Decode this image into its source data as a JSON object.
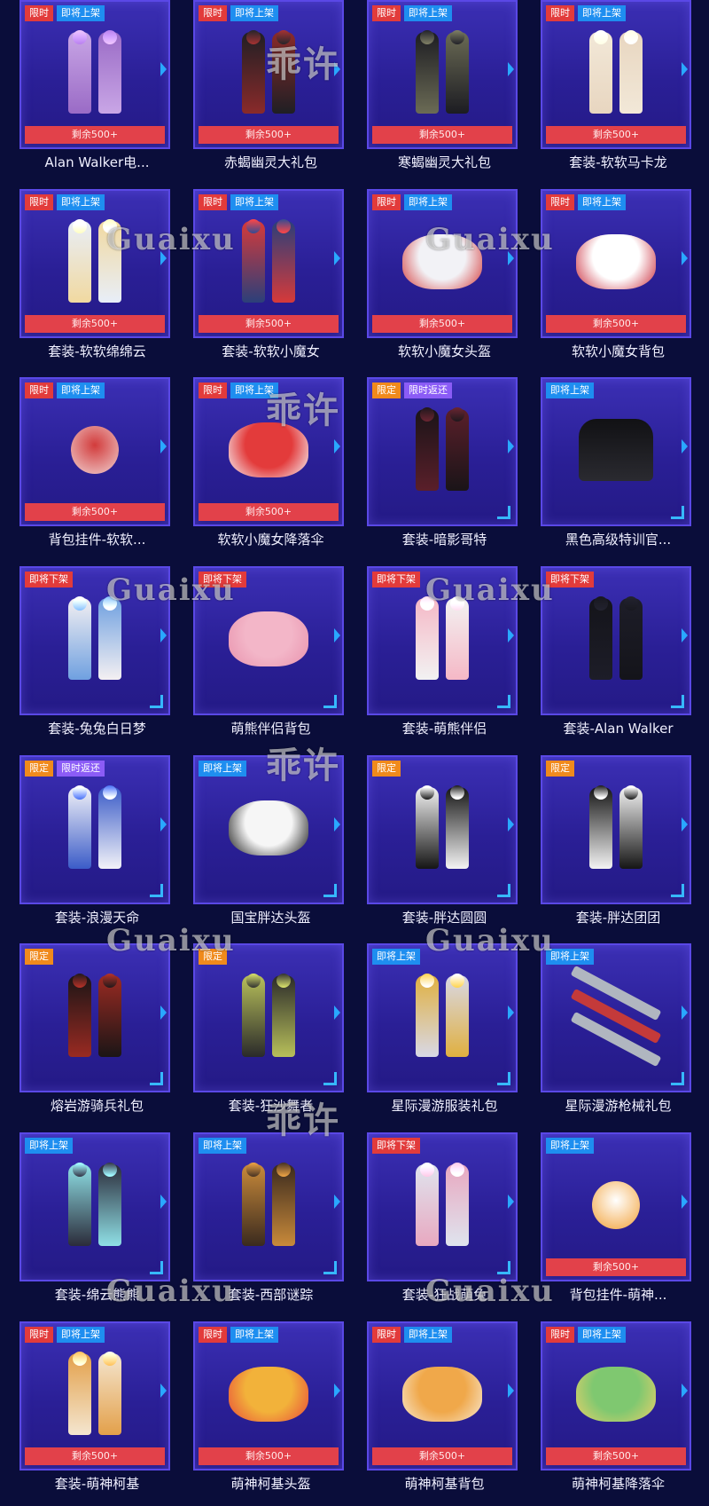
{
  "labels": {
    "limited": "限时",
    "fixed": "限定",
    "soon_on": "即将上架",
    "soon_off": "即将下架",
    "return": "限时返还",
    "remaining": "剩余500+"
  },
  "watermarks": [
    "乖许",
    "Guaixu"
  ],
  "colors": {
    "card": "#3b2fb4",
    "remaining_bar": "#e2414a",
    "badge_red": "#e23b3b",
    "badge_orange": "#f08a1c",
    "badge_blue": "#1e8ef0",
    "badge_purple": "#8b5cf6",
    "corner_accent": "#36b8ff"
  },
  "items": [
    {
      "name": "Alan Walker电...",
      "badges": [
        "limited",
        "soon_on"
      ],
      "remaining": true,
      "art": "figures",
      "tone": [
        "#c9a6e6",
        "#9a6bc6"
      ]
    },
    {
      "name": "赤蝎幽灵大礼包",
      "badges": [
        "limited",
        "soon_on"
      ],
      "remaining": true,
      "art": "figures",
      "tone": [
        "#1f1f24",
        "#8a2a2a"
      ]
    },
    {
      "name": "寒蝎幽灵大礼包",
      "badges": [
        "limited",
        "soon_on"
      ],
      "remaining": true,
      "art": "figures",
      "tone": [
        "#1c1c22",
        "#6b6b55"
      ]
    },
    {
      "name": "套装-软软马卡龙",
      "badges": [
        "limited",
        "soon_on"
      ],
      "remaining": true,
      "art": "figures",
      "tone": [
        "#f2e8d8",
        "#e8d6c0"
      ]
    },
    {
      "name": "套装-软软绵绵云",
      "badges": [
        "limited",
        "soon_on"
      ],
      "remaining": true,
      "art": "figures",
      "tone": [
        "#e8eef8",
        "#f1d9a0"
      ]
    },
    {
      "name": "套装-软软小魔女",
      "badges": [
        "limited",
        "soon_on"
      ],
      "remaining": true,
      "art": "figures",
      "tone": [
        "#d63a3a",
        "#2b3f7a"
      ]
    },
    {
      "name": "软软小魔女头盔",
      "badges": [
        "limited",
        "soon_on"
      ],
      "remaining": true,
      "art": "blob",
      "tone": [
        "#f2f2f6",
        "#d43a3a"
      ]
    },
    {
      "name": "软软小魔女背包",
      "badges": [
        "limited",
        "soon_on"
      ],
      "remaining": true,
      "art": "blob",
      "tone": [
        "#ffffff",
        "#c92a3a"
      ]
    },
    {
      "name": "背包挂件-软软...",
      "badges": [
        "limited",
        "soon_on"
      ],
      "remaining": true,
      "art": "charm",
      "tone": [
        "#f0d0d0",
        "#d23b3b"
      ]
    },
    {
      "name": "软软小魔女降落伞",
      "badges": [
        "limited",
        "soon_on"
      ],
      "remaining": true,
      "art": "blob",
      "tone": [
        "#e33b3b",
        "#f6f6fa"
      ]
    },
    {
      "name": "套装-暗影哥特",
      "badges": [
        "fixed",
        "return"
      ],
      "remaining": false,
      "art": "figures",
      "tone": [
        "#1a1418",
        "#5a1f2a"
      ]
    },
    {
      "name": "黑色高级特训官...",
      "badges": [
        "soon_on"
      ],
      "remaining": false,
      "art": "shirt",
      "tone": [
        "#111114",
        "#2a2a30"
      ]
    },
    {
      "name": "套装-兔兔白日梦",
      "badges": [
        "soon_off"
      ],
      "remaining": false,
      "art": "figures",
      "tone": [
        "#f4f0f2",
        "#6fa0e0"
      ]
    },
    {
      "name": "萌熊伴侣背包",
      "badges": [
        "soon_off"
      ],
      "remaining": false,
      "art": "blob",
      "tone": [
        "#f3b6c8",
        "#e892ad"
      ]
    },
    {
      "name": "套装-萌熊伴侣",
      "badges": [
        "soon_off"
      ],
      "remaining": false,
      "art": "figures",
      "tone": [
        "#f5b8c6",
        "#f2f2f2"
      ]
    },
    {
      "name": "套装-Alan Walker",
      "badges": [
        "soon_off"
      ],
      "remaining": false,
      "art": "figures",
      "tone": [
        "#14141a",
        "#1d1d28"
      ]
    },
    {
      "name": "套装-浪漫天命",
      "badges": [
        "fixed",
        "return"
      ],
      "remaining": false,
      "art": "figures",
      "tone": [
        "#f2f2f8",
        "#3b5cc8"
      ]
    },
    {
      "name": "国宝胖达头盔",
      "badges": [
        "soon_on"
      ],
      "remaining": false,
      "art": "blob",
      "tone": [
        "#f6f6f6",
        "#151515"
      ]
    },
    {
      "name": "套装-胖达圆圆",
      "badges": [
        "fixed"
      ],
      "remaining": false,
      "art": "figures",
      "tone": [
        "#f4f4f4",
        "#151515"
      ]
    },
    {
      "name": "套装-胖达团团",
      "badges": [
        "fixed"
      ],
      "remaining": false,
      "art": "figures",
      "tone": [
        "#151515",
        "#f4f4f4"
      ]
    },
    {
      "name": "熔岩游骑兵礼包",
      "badges": [
        "fixed"
      ],
      "remaining": false,
      "art": "figures",
      "tone": [
        "#1b1516",
        "#9a2a22"
      ]
    },
    {
      "name": "套装-狂沙舞者",
      "badges": [
        "fixed"
      ],
      "remaining": false,
      "art": "figures",
      "tone": [
        "#b8c05a",
        "#2a2a2a"
      ]
    },
    {
      "name": "星际漫游服装礼包",
      "badges": [
        "soon_on"
      ],
      "remaining": false,
      "art": "figures",
      "tone": [
        "#e0b040",
        "#d8d8e6"
      ]
    },
    {
      "name": "星际漫游枪械礼包",
      "badges": [
        "soon_on"
      ],
      "remaining": false,
      "art": "guns",
      "tone": [
        "#b0b6c0",
        "#c43a3a"
      ]
    },
    {
      "name": "套装-绵云熊熊",
      "badges": [
        "soon_on"
      ],
      "remaining": false,
      "art": "figures",
      "tone": [
        "#8fe0e6",
        "#2b2b3a"
      ]
    },
    {
      "name": "套装-西部谜踪",
      "badges": [
        "soon_on"
      ],
      "remaining": false,
      "art": "figures",
      "tone": [
        "#c98a3a",
        "#3a2a1e"
      ]
    },
    {
      "name": "套装-狂战萌兔",
      "badges": [
        "soon_off"
      ],
      "remaining": false,
      "art": "figures",
      "tone": [
        "#dfe4ee",
        "#e8a8c0"
      ]
    },
    {
      "name": "背包挂件-萌神...",
      "badges": [
        "soon_on"
      ],
      "remaining": true,
      "art": "charm",
      "tone": [
        "#f2a23a",
        "#ffffff"
      ]
    },
    {
      "name": "套装-萌神柯基",
      "badges": [
        "limited",
        "soon_on"
      ],
      "remaining": true,
      "art": "figures",
      "tone": [
        "#e3a04a",
        "#f4e6d0"
      ]
    },
    {
      "name": "萌神柯基头盔",
      "badges": [
        "limited",
        "soon_on"
      ],
      "remaining": true,
      "art": "blob",
      "tone": [
        "#f2b23a",
        "#e84a3a"
      ]
    },
    {
      "name": "萌神柯基背包",
      "badges": [
        "limited",
        "soon_on"
      ],
      "remaining": true,
      "art": "blob",
      "tone": [
        "#f0a84a",
        "#f7e8d0"
      ]
    },
    {
      "name": "萌神柯基降落伞",
      "badges": [
        "limited",
        "soon_on"
      ],
      "remaining": true,
      "art": "blob",
      "tone": [
        "#7fc870",
        "#e8d06a"
      ]
    }
  ]
}
